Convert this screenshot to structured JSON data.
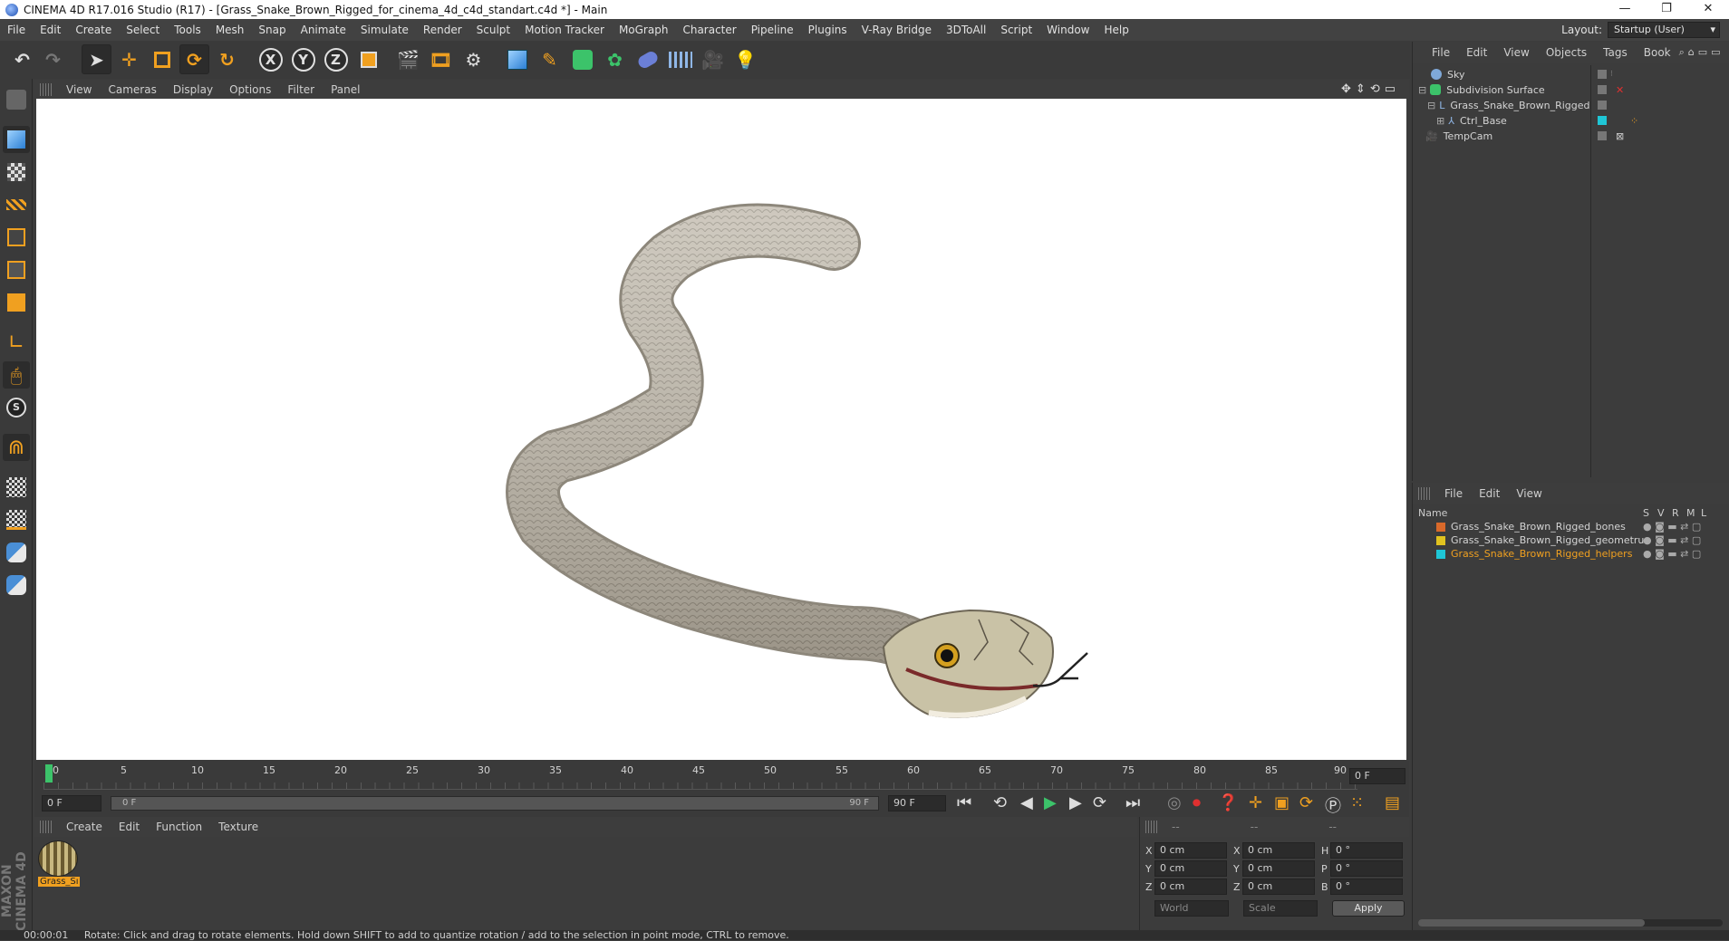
{
  "window": {
    "title": "CINEMA 4D R17.016 Studio (R17) - [Grass_Snake_Brown_Rigged_for_cinema_4d_c4d_standart.c4d *] - Main",
    "minimize": "—",
    "restore": "❐",
    "close": "✕"
  },
  "menubar": {
    "items": [
      "File",
      "Edit",
      "Create",
      "Select",
      "Tools",
      "Mesh",
      "Snap",
      "Animate",
      "Simulate",
      "Render",
      "Sculpt",
      "Motion Tracker",
      "MoGraph",
      "Character",
      "Pipeline",
      "Plugins",
      "V-Ray Bridge",
      "3DToAll",
      "Script",
      "Window",
      "Help"
    ],
    "layout_label": "Layout:",
    "layout_value": "Startup (User)"
  },
  "toolbar": {
    "axis_x": "X",
    "axis_y": "Y",
    "axis_z": "Z"
  },
  "viewport": {
    "menu": [
      "View",
      "Cameras",
      "Display",
      "Options",
      "Filter",
      "Panel"
    ]
  },
  "timeline": {
    "ticks": [
      "0",
      "5",
      "10",
      "15",
      "20",
      "25",
      "30",
      "35",
      "40",
      "45",
      "50",
      "55",
      "60",
      "65",
      "70",
      "75",
      "80",
      "85",
      "90"
    ],
    "current_frame_field": "0 F",
    "start_field": "0 F",
    "range_start_label": "0 F",
    "range_end_label": "90 F",
    "end_field": "90 F"
  },
  "material_panel": {
    "menu": [
      "Create",
      "Edit",
      "Function",
      "Texture"
    ],
    "materials": [
      {
        "name": "Grass_Sı"
      }
    ]
  },
  "coordinates": {
    "header_dashes": [
      "--",
      "--",
      "--"
    ],
    "rows": [
      {
        "a": "X",
        "a_val": "0 cm",
        "b": "X",
        "b_val": "0 cm",
        "c": "H",
        "c_val": "0 °"
      },
      {
        "a": "Y",
        "a_val": "0 cm",
        "b": "Y",
        "b_val": "0 cm",
        "c": "P",
        "c_val": "0 °"
      },
      {
        "a": "Z",
        "a_val": "0 cm",
        "b": "Z",
        "b_val": "0 cm",
        "c": "B",
        "c_val": "0 °"
      }
    ],
    "space_select": "World",
    "mode_select": "Scale",
    "apply_label": "Apply"
  },
  "object_manager": {
    "menu": [
      "File",
      "Edit",
      "View",
      "Objects",
      "Tags",
      "Book"
    ],
    "objects": [
      {
        "name": "Sky",
        "indent": 0
      },
      {
        "name": "Subdivision Surface",
        "indent": 0
      },
      {
        "name": "Grass_Snake_Brown_Rigged",
        "indent": 1
      },
      {
        "name": "Ctrl_Base",
        "indent": 2
      },
      {
        "name": "TempCam",
        "indent": 0
      }
    ]
  },
  "layer_manager": {
    "menu": [
      "File",
      "Edit",
      "View"
    ],
    "columns": {
      "name": "Name",
      "s": "S",
      "v": "V",
      "r": "R",
      "m": "M",
      "l": "L"
    },
    "layers": [
      {
        "name": "Grass_Snake_Brown_Rigged_bones",
        "color": "#d9692a"
      },
      {
        "name": "Grass_Snake_Brown_Rigged_geometru",
        "color": "#e0c21f"
      },
      {
        "name": "Grass_Snake_Brown_Rigged_helpers",
        "color": "#1fc6d6"
      }
    ]
  },
  "status": {
    "time": "00:00:01",
    "message": "Rotate: Click and drag to rotate elements. Hold down SHIFT to add to quantize rotation / add to the selection in point mode, CTRL to remove."
  },
  "colors": {
    "accent_orange": "#f0a020",
    "accent_blue": "#4aa3e8",
    "layer_helpers_text": "#f0a020"
  }
}
